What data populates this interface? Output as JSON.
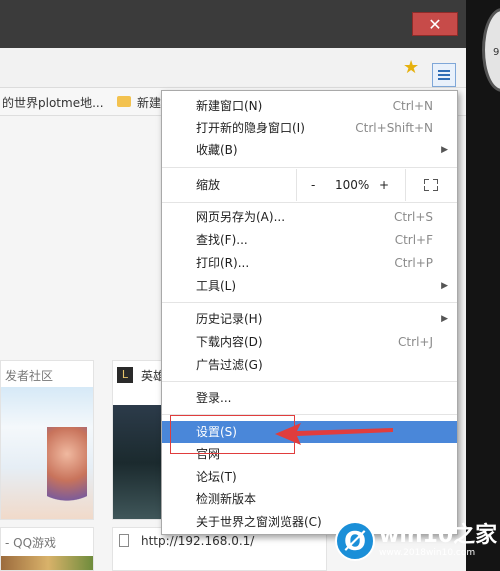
{
  "window": {
    "close_glyph": "✕"
  },
  "toolbar": {
    "bookmark_star": "★"
  },
  "bookmarks": [
    {
      "label": "的世界plotme地..."
    },
    {
      "label": "新建"
    }
  ],
  "tiles": [
    {
      "title": "发者社区"
    },
    {
      "title": "英雄",
      "logo": "L"
    },
    {
      "title": "- QQ游戏"
    },
    {
      "title": "http://192.168.0.1/"
    }
  ],
  "menu": {
    "items_top": [
      {
        "label": "新建窗口(N)",
        "shortcut": "Ctrl+N"
      },
      {
        "label": "打开新的隐身窗口(I)",
        "shortcut": "Ctrl+Shift+N"
      },
      {
        "label": "收藏(B)",
        "submenu": "▶"
      }
    ],
    "zoom": {
      "label": "缩放",
      "minus": "-",
      "value": "100%",
      "plus": "+"
    },
    "items_edit": [
      {
        "label": "网页另存为(A)...",
        "shortcut": "Ctrl+S"
      },
      {
        "label": "查找(F)...",
        "shortcut": "Ctrl+F"
      },
      {
        "label": "打印(R)...",
        "shortcut": "Ctrl+P"
      },
      {
        "label": "工具(L)",
        "submenu": "▶"
      }
    ],
    "items_history": [
      {
        "label": "历史记录(H)",
        "submenu": "▶"
      },
      {
        "label": "下载内容(D)",
        "shortcut": "Ctrl+J"
      },
      {
        "label": "广告过滤(G)"
      }
    ],
    "login": {
      "label": "登录..."
    },
    "items_bottom": [
      {
        "label": "设置(S)",
        "highlighted": true
      },
      {
        "label": "官网"
      },
      {
        "label": "论坛(T)"
      },
      {
        "label": "检测新版本"
      },
      {
        "label": "关于世界之窗浏览器(C)"
      }
    ]
  },
  "annotation": {
    "box_color": "#e03d3d",
    "arrow_color": "#e03d3d"
  },
  "watermark": {
    "logo": "Ø",
    "brand": "win10之家",
    "url": "www.2018win10.com"
  },
  "clock": {
    "number": "9"
  },
  "colors": {
    "highlight": "#4a87d9",
    "close_button": "#c74b49",
    "titlebar": "#3b3b3b"
  }
}
